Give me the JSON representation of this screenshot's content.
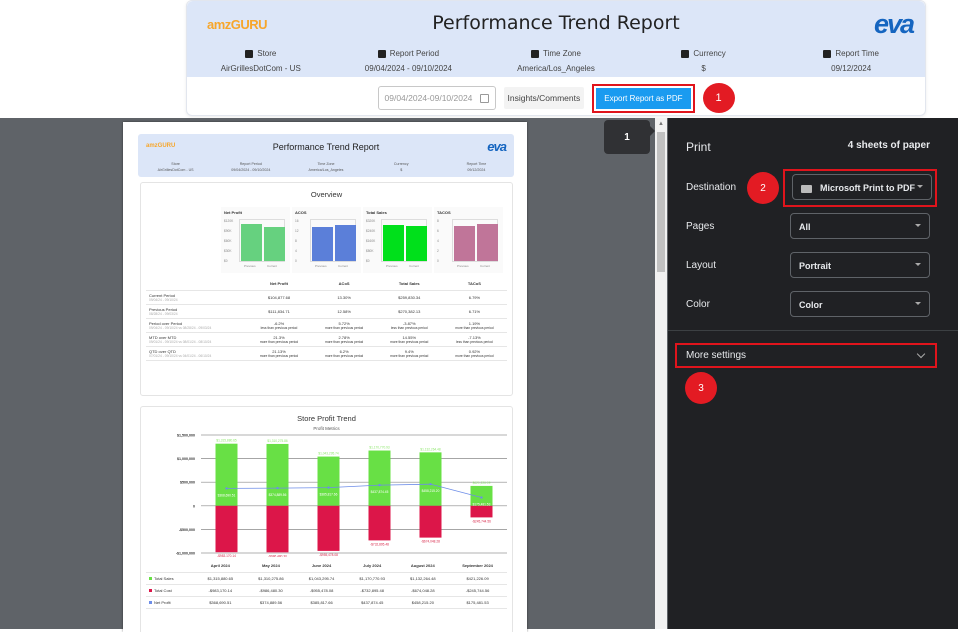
{
  "report": {
    "logo_left": "amzGURU",
    "title": "Performance Trend Report",
    "logo_right": "eva",
    "meta": [
      {
        "icon": "store-icon",
        "label": "Store",
        "value": "AirGrillesDotCom - US"
      },
      {
        "icon": "calendar-icon",
        "label": "Report Period",
        "value": "09/04/2024 - 09/10/2024"
      },
      {
        "icon": "calendar-clock-icon",
        "label": "Time Zone",
        "value": "America/Los_Angeles"
      },
      {
        "icon": "currency-icon",
        "label": "Currency",
        "value": "$"
      },
      {
        "icon": "calendar-check-icon",
        "label": "Report Time",
        "value": "09/12/2024"
      }
    ],
    "date_input": "09/04/2024-09/10/2024",
    "insights_label": "Insights/Comments",
    "export_label": "Export Report as PDF",
    "step1": "1"
  },
  "preview": {
    "page_badge": "1",
    "overview": {
      "title": "Overview",
      "minis": [
        {
          "title": "Net Profit",
          "ticks": [
            "$120K",
            "$90K",
            "$60K",
            "$30K",
            "$0"
          ],
          "max": 120000,
          "values": [
            104000,
            94000
          ],
          "color": "#66d17f"
        },
        {
          "title": "ACOS",
          "ticks": [
            "16",
            "12",
            "8",
            "4",
            "0"
          ],
          "max": 16,
          "values": [
            12.6,
            13.3
          ],
          "color": "#5b7fd9"
        },
        {
          "title": "Total Sales",
          "ticks": [
            "$320K",
            "$240K",
            "$160K",
            "$80K",
            "$0"
          ],
          "max": 320000,
          "values": [
            270382,
            259830
          ],
          "color": "#00e01b"
        },
        {
          "title": "TACOS",
          "ticks": [
            "8",
            "6",
            "4",
            "2",
            "0"
          ],
          "max": 8,
          "values": [
            6.6,
            6.8
          ],
          "color": "#c07599"
        }
      ],
      "x_labels": [
        "Previous",
        "Current"
      ],
      "headers": [
        "",
        "Net Profit",
        "ACoS",
        "Total Sales",
        "TACoS"
      ],
      "rows": [
        {
          "label": "Current Period",
          "dates": "09/04/24 - 09/10/24",
          "cells": [
            {
              "v": "$104,877.68"
            },
            {
              "v": "13.30%"
            },
            {
              "v": "$259,830.34"
            },
            {
              "v": "6.79%"
            }
          ]
        },
        {
          "label": "Previous Period",
          "dates": "08/28/24 - 09/03/24",
          "cells": [
            {
              "v": "$111,834.71"
            },
            {
              "v": "12.58%"
            },
            {
              "v": "$270,382.13"
            },
            {
              "v": "6.71%"
            }
          ]
        },
        {
          "label": "Period over Period",
          "dates": "09/04/24 - 09/10/24 vs 08/28/24 - 09/03/24",
          "cells": [
            {
              "v": "-6.2%",
              "n": "less than previous period",
              "c": "neg"
            },
            {
              "v": "5.72%",
              "n": "more than previous period",
              "c": "neg"
            },
            {
              "v": "-3.87%",
              "n": "less than previous period",
              "c": "neg"
            },
            {
              "v": "1.19%",
              "n": "more than previous period",
              "c": "neg"
            }
          ]
        },
        {
          "label": "MTD over MTD",
          "dates": "09/01/24 - 09/10/24 vs 08/01/24 - 08/10/24",
          "cells": [
            {
              "v": "21.3%",
              "n": "more than previous period",
              "c": "pos"
            },
            {
              "v": "2.78%",
              "n": "more than previous period",
              "c": "neg"
            },
            {
              "v": "14.55%",
              "n": "more than previous period",
              "c": "pos"
            },
            {
              "v": "-7.13%",
              "n": "less than previous period",
              "c": "pos"
            }
          ]
        },
        {
          "label": "QTD over QTD",
          "dates": "07/01/24 - 09/10/24 vs 04/01/24 - 06/10/24",
          "cells": [
            {
              "v": "21.13%",
              "n": "more than previous period",
              "c": "pos"
            },
            {
              "v": "6.2%",
              "n": "more than previous period",
              "c": "neg"
            },
            {
              "v": "9.4%",
              "n": "more than previous period",
              "c": "pos"
            },
            {
              "v": "0.92%",
              "n": "more than previous period",
              "c": "neg"
            }
          ]
        }
      ]
    },
    "trend": {
      "title": "Store Profit Trend",
      "subtitle": "Profit Metrics"
    }
  },
  "chart_data": {
    "type": "bar",
    "title": "Store Profit Trend",
    "subtitle": "Profit Metrics",
    "categories": [
      "April 2024",
      "May 2024",
      "June 2024",
      "July 2024",
      "August 2024",
      "September 2024"
    ],
    "series": [
      {
        "name": "Total Sales",
        "color": "#68e045",
        "values": [
          1315880.65,
          1310275.86,
          1043295.74,
          1170770.93,
          1132264.48,
          421226.09
        ],
        "labels": [
          "$1,315,880.65",
          "$1,310,275.86",
          "$1,043,295.74",
          "$1,170,770.93",
          "$1,132,264.48",
          "$421,226.09"
        ]
      },
      {
        "name": "Total Cost",
        "color": "#dc1649",
        "values": [
          -983170.14,
          -986480.3,
          -955478.08,
          -732895.48,
          -674048.28,
          -245744.56
        ],
        "labels": [
          "-$983,170.14",
          "-$986,480.30",
          "-$955,478.08",
          "-$732,895.48",
          "-$674,048.28",
          "-$245,744.56"
        ]
      },
      {
        "name": "Net Profit",
        "color": "#6d8de8",
        "values": [
          368690.51,
          374889.56,
          385817.66,
          437874.45,
          458215.2,
          175481.53
        ],
        "labels": [
          "$368,690.51",
          "$374,889.56",
          "$385,817.66",
          "$437,874.45",
          "$458,215.20",
          "$175,481.53"
        ]
      }
    ],
    "yticks": [
      "$1,500,000",
      "$1,000,000",
      "$500,000",
      "0",
      "-$500,000",
      "-$1,000,000"
    ],
    "ylim": [
      -1000000,
      1500000
    ],
    "grid": true
  },
  "print": {
    "title": "Print",
    "sheets": "4 sheets of paper",
    "destination_label": "Destination",
    "destination_value": "Microsoft Print to PDF",
    "pages_label": "Pages",
    "pages_value": "All",
    "layout_label": "Layout",
    "layout_value": "Portrait",
    "color_label": "Color",
    "color_value": "Color",
    "more_settings": "More settings",
    "step2": "2",
    "step3": "3"
  }
}
